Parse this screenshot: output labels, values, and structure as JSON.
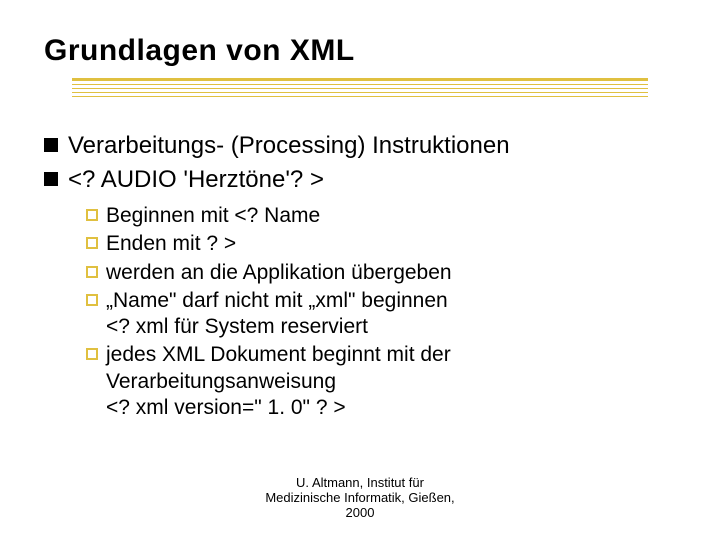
{
  "title": "Grundlagen von XML",
  "level1": [
    "Verarbeitungs- (Processing) Instruktionen",
    "<? AUDIO 'Herztöne'? >"
  ],
  "level2": [
    "Beginnen mit <? Name",
    "Enden mit        ? >",
    "werden an die Applikation übergeben",
    "„Name\" darf nicht mit „xml\" beginnen\n<? xml für System reserviert",
    "jedes XML Dokument beginnt mit der\nVerarbeitungsanweisung\n<? xml version=\" 1. 0\"    ? >"
  ],
  "footer": "U. Altmann, Institut für\nMedizinische Informatik, Gießen,\n2000"
}
